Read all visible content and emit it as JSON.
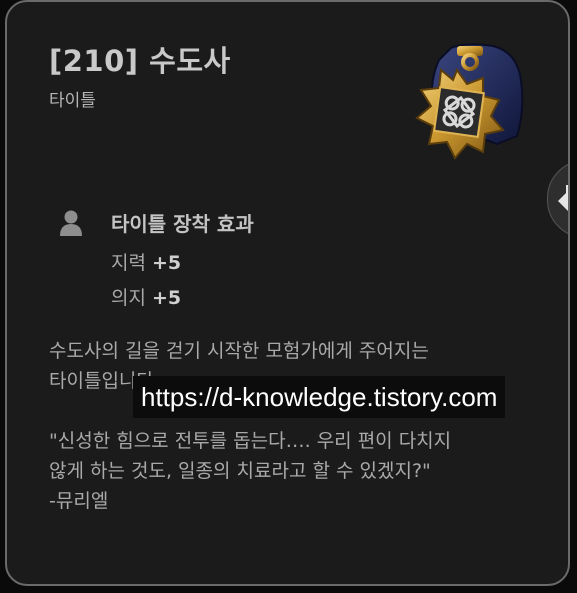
{
  "title": {
    "name": "[210] 수도사",
    "category": "타이틀"
  },
  "icons": {
    "emblem": "title-medal-emblem",
    "effect": "person-icon",
    "side_tab": "arrow-left-icon"
  },
  "effect": {
    "heading": "타이틀 장착 효과",
    "stats": [
      {
        "label": "지력",
        "value": "+5"
      },
      {
        "label": "의지",
        "value": "+5"
      }
    ]
  },
  "description": {
    "lines": [
      "수도사의 길을 걷기 시작한 모험가에게 주어지는",
      "타이틀입니다."
    ]
  },
  "quote": {
    "lines": [
      "\"신성한 힘으로 전투를 돕는다…. 우리 편이 다치지",
      "않게 하는 것도, 일종의 치료라고 할 수 있겠지?\"",
      "-뮤리엘"
    ]
  },
  "watermark": "https://d-knowledge.tistory.com",
  "colors": {
    "card_bg": "#1b1b1b",
    "border": "#6a6a6a",
    "text": "#a9a9a9",
    "gold": "#c9962e",
    "navy": "#1c2350"
  }
}
